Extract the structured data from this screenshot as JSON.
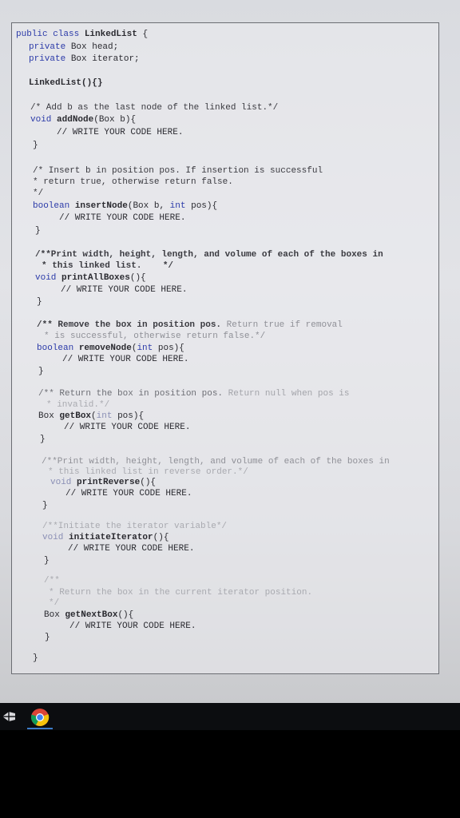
{
  "code": {
    "class_decl": {
      "kw": "public class",
      "name": "LinkedList",
      "brace": "{"
    },
    "field_head": {
      "kw": "private",
      "rest": "Box head;"
    },
    "field_iter": {
      "kw": "private",
      "rest": "Box iterator;"
    },
    "constructor": "LinkedList(){}",
    "add_comment": "/* Add b as the last node of the linked list.*/",
    "add_sig": {
      "kw": "void",
      "name": "addNode",
      "params": "(Box b){"
    },
    "todo": "// WRITE YOUR CODE HERE.",
    "close": "}",
    "insert_comment_1": "/* Insert b in position pos. If insertion is successful",
    "insert_comment_2": "* return true, otherwise return false.",
    "insert_comment_3": "*/",
    "insert_sig": {
      "kw": "boolean",
      "name": "insertNode",
      "params_a": "(Box b,",
      "kw2": "int",
      "params_b": "pos){"
    },
    "print_comment_1": "/**Print width, height, length, and volume of each of the boxes in",
    "print_comment_2": "* this linked list.    */",
    "print_sig": {
      "kw": "void",
      "name": "printAllBoxes",
      "params": "(){"
    },
    "remove_comment_1a": "/** Remove the box in position pos.",
    "remove_comment_1b": "Return true if removal",
    "remove_comment_2": "* is successful, otherwise return false.*/",
    "remove_sig": {
      "kw": "boolean",
      "name": "removeNode",
      "params_a": "(",
      "kw2": "int",
      "params_b": "pos){"
    },
    "get_comment_1a": "/** Return the box in position pos.",
    "get_comment_1b": "Return null when pos is",
    "get_comment_2": "* invalid.*/",
    "get_sig": {
      "kw": "Box",
      "name": "getBox",
      "params_a": "(",
      "kw2": "int",
      "params_b": "pos){"
    },
    "rev_comment_1": "/**Print width, height, length, and volume of each of the boxes in",
    "rev_comment_2": "* this linked list in reverse order.*/",
    "rev_sig": {
      "kw": "void",
      "name": "printReverse",
      "params": "(){"
    },
    "init_comment": "/**Initiate the iterator variable*/",
    "init_sig": {
      "kw": "void",
      "name": "initiateIterator",
      "params": "(){"
    },
    "next_comment_1": "/**",
    "next_comment_2": "* Return the box in the current iterator position.",
    "next_comment_3": "*/",
    "next_sig": {
      "kw": "Box",
      "name": "getNextBox",
      "params": "(){"
    }
  },
  "taskbar": {
    "start_icon": "windows-start-icon",
    "app_icon": "chrome-icon"
  },
  "colors": {
    "keyword": "#2b3aa8",
    "text": "#2a2a30",
    "screen_bg": "#e2e3e7",
    "taskbar_bg": "#0c0d10"
  }
}
